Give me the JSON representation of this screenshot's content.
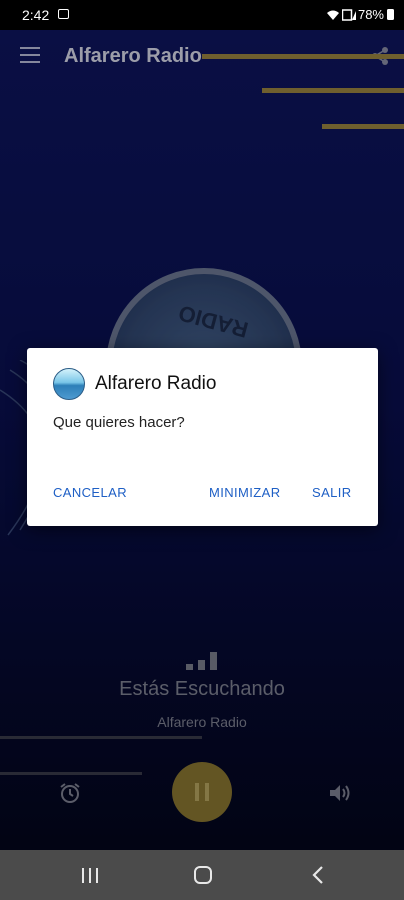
{
  "status_bar": {
    "time": "2:42",
    "battery": "78%",
    "icons": [
      "image-icon",
      "wifi-icon",
      "signal-icon",
      "battery-icon"
    ]
  },
  "toolbar": {
    "title": "Alfarero Radio",
    "menu_icon": "menu-icon",
    "share_icon": "share-icon"
  },
  "logo": {
    "text": "RADIO"
  },
  "player": {
    "listening_label": "Estás Escuchando",
    "station_name": "Alfarero Radio",
    "state": "playing",
    "accent_color": "#8a7731"
  },
  "dialog": {
    "title": "Alfarero Radio",
    "message": "Que quieres hacer?",
    "cancel_label": "CANCELAR",
    "minimize_label": "MINIMIZAR",
    "exit_label": "SALIR",
    "button_color": "#1e5fc5"
  },
  "navbar": {
    "icons": [
      "recent-apps-icon",
      "home-icon",
      "back-icon"
    ]
  }
}
